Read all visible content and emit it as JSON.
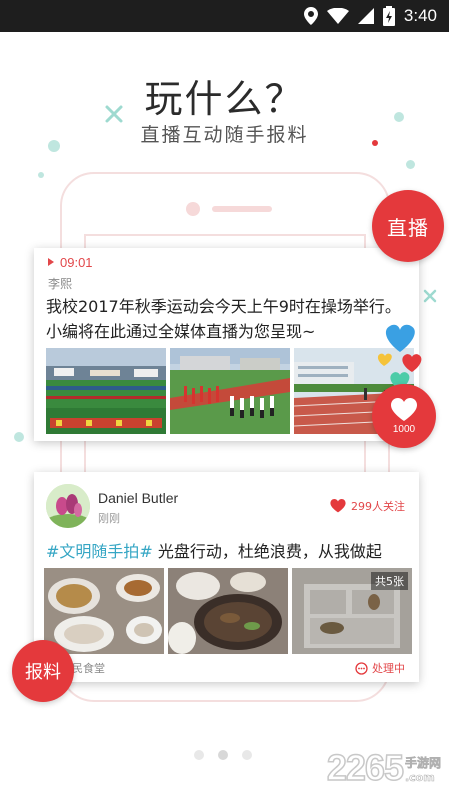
{
  "status_bar": {
    "time": "3:40",
    "icons": [
      "location-icon",
      "wifi-icon",
      "signal-icon",
      "battery-icon"
    ]
  },
  "header": {
    "title": "玩什么？",
    "subtitle": "直播互动随手报料"
  },
  "live_card": {
    "time": "09:01",
    "author": "李熙",
    "text": "我校2017年秋季运动会今天上午9时在操场举行。小编将在此通过全媒体直播为您呈现~",
    "photos": [
      "sports-field-photo",
      "parade-photo",
      "track-photo"
    ]
  },
  "post_card": {
    "name": "Daniel Butler",
    "when": "刚刚",
    "follow": "299人关注",
    "hashtag": "#文明随手拍#",
    "text": " 光盘行动，杜绝浪费，从我做起",
    "photo_count": "共5张",
    "location": "民食堂",
    "status": "处理中"
  },
  "buttons": {
    "live": "直播",
    "like_count": "1000",
    "report": "报料"
  },
  "watermark": {
    "big": "2265",
    "small": "手游网",
    "domain": ".com"
  },
  "colors": {
    "accent": "#e4393c",
    "tag": "#35a6c4"
  }
}
